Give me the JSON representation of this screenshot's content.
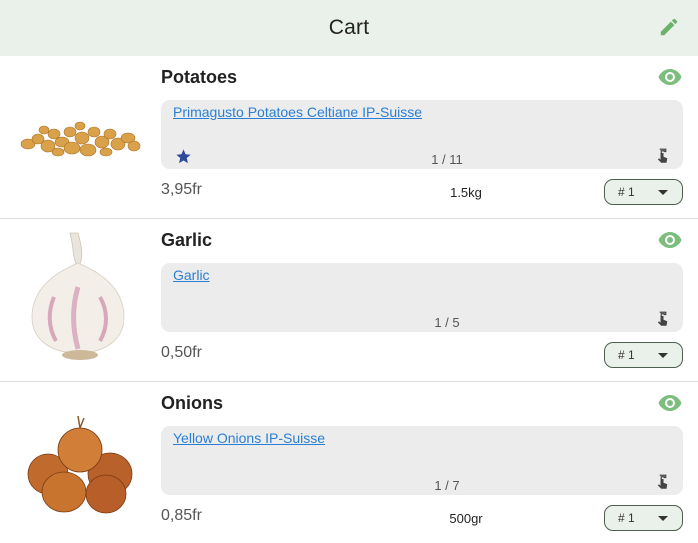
{
  "header": {
    "title": "Cart",
    "edit_icon": "pencil-icon",
    "accent_color": "#6bb36b"
  },
  "items": [
    {
      "name": "Potatoes",
      "link": "Primagusto Potatoes Celtiane IP-Suisse",
      "pager": "1 / 11",
      "price": "3,95fr",
      "quantity": "1.5kg",
      "select": "# 1",
      "starred": true,
      "icons": [
        "eye-icon",
        "star-icon",
        "touch-icon",
        "dropdown-caret-icon"
      ]
    },
    {
      "name": "Garlic",
      "link": "Garlic",
      "pager": "1 / 5",
      "price": "0,50fr",
      "quantity": "",
      "select": "# 1",
      "starred": false,
      "icons": [
        "eye-icon",
        "touch-icon",
        "dropdown-caret-icon"
      ]
    },
    {
      "name": "Onions",
      "link": "Yellow Onions IP-Suisse",
      "pager": "1 / 7",
      "price": "0,85fr",
      "quantity": "500gr",
      "select": "# 1",
      "starred": false,
      "icons": [
        "eye-icon",
        "touch-icon",
        "dropdown-caret-icon"
      ]
    }
  ]
}
